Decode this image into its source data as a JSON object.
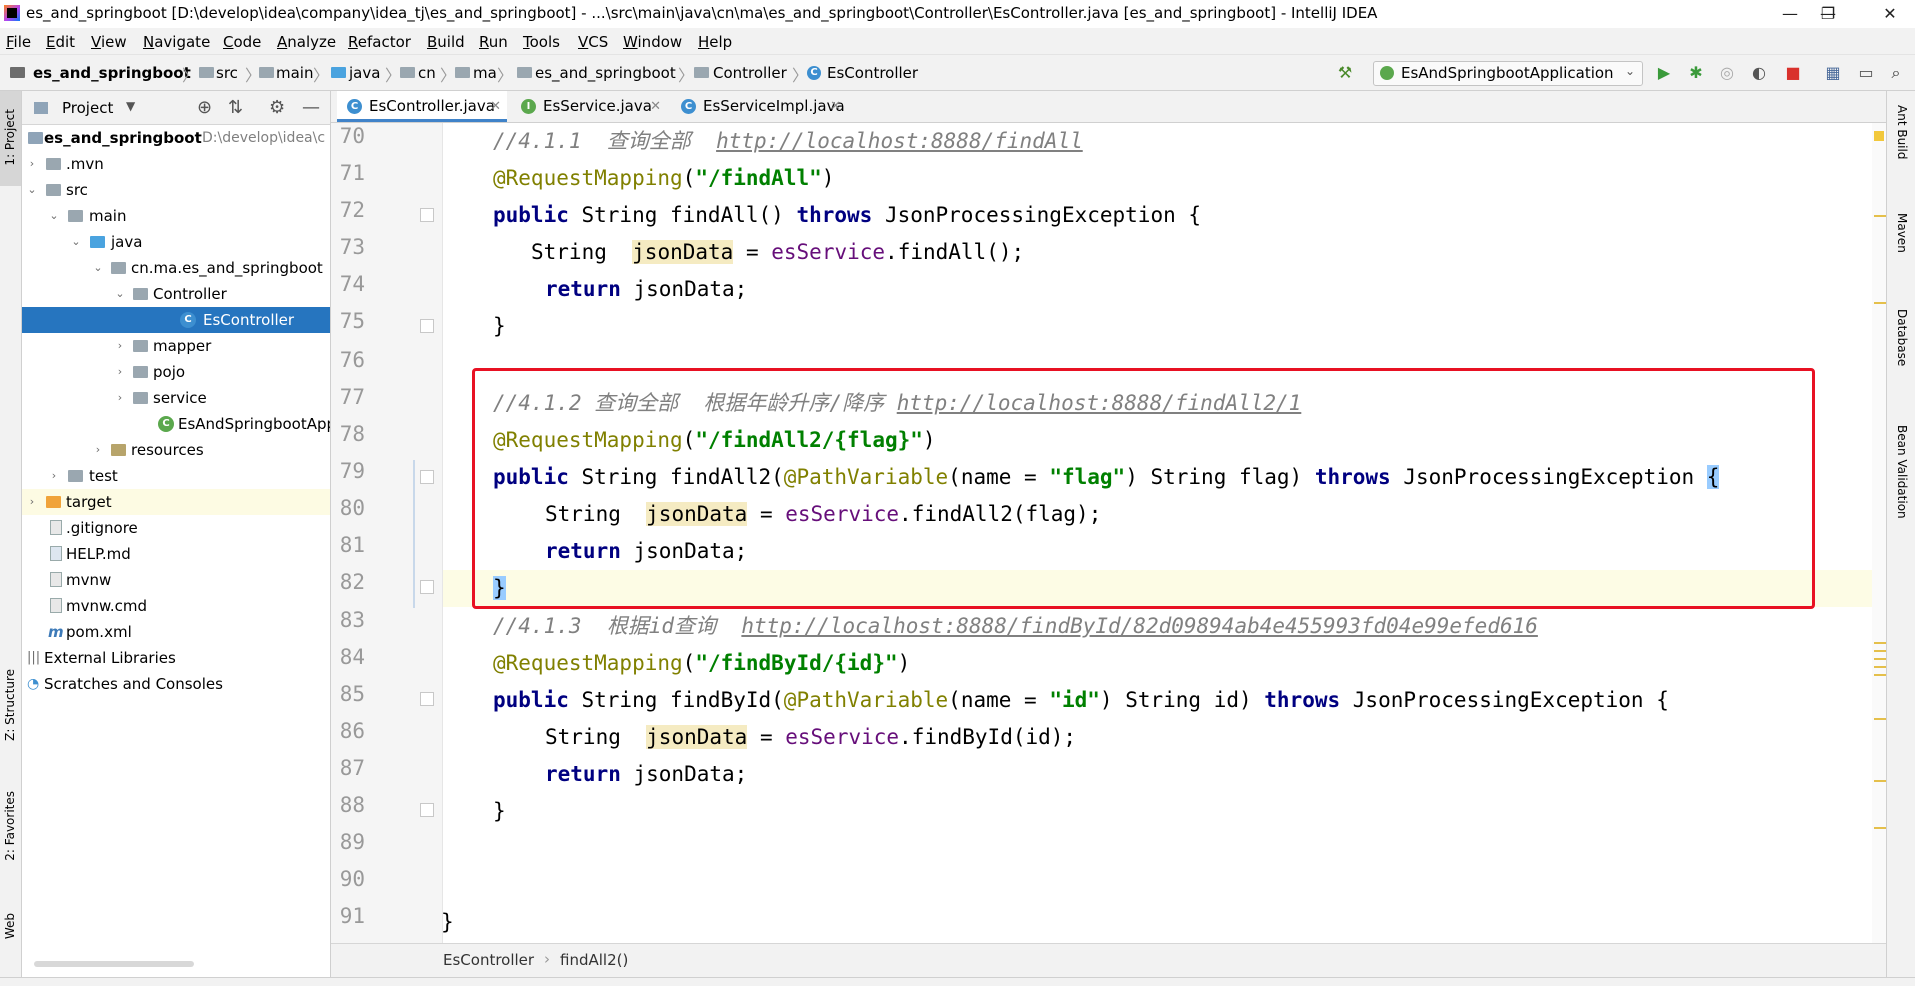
{
  "window": {
    "title": "es_and_springboot [D:\\develop\\idea\\company\\idea_tj\\es_and_springboot] - ...\\src\\main\\java\\cn\\ma\\es_and_springboot\\Controller\\EsController.java [es_and_springboot] - IntelliJ IDEA",
    "minimize": "—",
    "maximize": "❐",
    "close": "✕"
  },
  "menu": [
    "File",
    "Edit",
    "View",
    "Navigate",
    "Code",
    "Analyze",
    "Refactor",
    "Build",
    "Run",
    "Tools",
    "VCS",
    "Window",
    "Help"
  ],
  "nav": {
    "crumbs": [
      "es_and_springboot",
      "src",
      "main",
      "java",
      "cn",
      "ma",
      "es_and_springboot",
      "Controller",
      "EsController"
    ],
    "run_config": "EsAndSpringbootApplication"
  },
  "left_stripe": {
    "project": "1: Project",
    "structure": "Z: Structure",
    "favorites": "2: Favorites",
    "web": "Web"
  },
  "right_stripe": {
    "ant": "Ant Build",
    "maven": "Maven",
    "database": "Database",
    "bean": "Bean Validation"
  },
  "project": {
    "title": "Project",
    "tree": [
      {
        "label": "es_and_springboot",
        "extra": "D:\\develop\\idea\\c"
      },
      {
        "label": ".mvn"
      },
      {
        "label": "src"
      },
      {
        "label": "main"
      },
      {
        "label": "java"
      },
      {
        "label": "cn.ma.es_and_springboot"
      },
      {
        "label": "Controller"
      },
      {
        "label": "EsController"
      },
      {
        "label": "mapper"
      },
      {
        "label": "pojo"
      },
      {
        "label": "service"
      },
      {
        "label": "EsAndSpringbootApplication"
      },
      {
        "label": "resources"
      },
      {
        "label": "test"
      },
      {
        "label": "target"
      },
      {
        "label": ".gitignore"
      },
      {
        "label": "HELP.md"
      },
      {
        "label": "mvnw"
      },
      {
        "label": "mvnw.cmd"
      },
      {
        "label": "pom.xml"
      },
      {
        "label": "External Libraries"
      },
      {
        "label": "Scratches and Consoles"
      }
    ]
  },
  "tabs": [
    "EsController.java",
    "EsService.java",
    "EsServiceImpl.java"
  ],
  "line_numbers": [
    "70",
    "71",
    "72",
    "73",
    "74",
    "75",
    "76",
    "77",
    "78",
    "79",
    "80",
    "81",
    "82",
    "83",
    "84",
    "85",
    "86",
    "87",
    "88",
    "89",
    "90",
    "91"
  ],
  "code": {
    "l70_c": "//4.1.1  查询全部  ",
    "l70_u": "http://localhost:8888/findAll",
    "l71_a": "@RequestMapping",
    "l71_s": "\"/findAll\"",
    "l72_k1": "public",
    "l72_m": " String findAll() ",
    "l72_k2": "throws",
    "l72_e": " JsonProcessingException {",
    "l73_a": "String  ",
    "l73_v": "jsonData",
    "l73_b": " = ",
    "l73_f": "esService",
    "l73_c": ".findAll();",
    "l74_k": "return",
    "l74_r": " jsonData;",
    "l75": "}",
    "l77_c": "//4.1.2 查询全部  根据年龄升序/降序 ",
    "l77_u": "http://localhost:8888/findAll2/1",
    "l78_a": "@RequestMapping",
    "l78_s": "\"/findAll2/{flag}\"",
    "l79_k1": "public",
    "l79_m": " String findAll2(",
    "l79_a": "@PathVariable",
    "l79_n": "(name = ",
    "l79_s": "\"flag\"",
    "l79_p": ") String flag) ",
    "l79_k2": "throws",
    "l79_e": " JsonProcessingException ",
    "l79_b": "{",
    "l80_a": "String  ",
    "l80_v": "jsonData",
    "l80_b": " = ",
    "l80_f": "esService",
    "l80_c": ".findAll2(flag);",
    "l81_k": "return",
    "l81_r": " jsonData;",
    "l82": "}",
    "l83_c": "//4.1.3  根据id查询  ",
    "l83_u": "http://localhost:8888/findById/82d09894ab4e455993fd04e99efed616",
    "l84_a": "@RequestMapping",
    "l84_s": "\"/findById/{id}\"",
    "l85_k1": "public",
    "l85_m": " String findById(",
    "l85_a": "@PathVariable",
    "l85_n": "(name = ",
    "l85_s": "\"id\"",
    "l85_p": ") String id) ",
    "l85_k2": "throws",
    "l85_e": " JsonProcessingException {",
    "l86_a": "String  ",
    "l86_v": "jsonData",
    "l86_b": " = ",
    "l86_f": "esService",
    "l86_c": ".findById(id);",
    "l87_k": "return",
    "l87_r": " jsonData;",
    "l88": "}",
    "l91": "}"
  },
  "editor_breadcrumb": [
    "EsController",
    "findAll2()"
  ],
  "colors": {
    "selection": "#2675bf",
    "highlight_box": "#e81123",
    "keyword": "#000080",
    "annotation": "#808000",
    "string": "#008000"
  }
}
